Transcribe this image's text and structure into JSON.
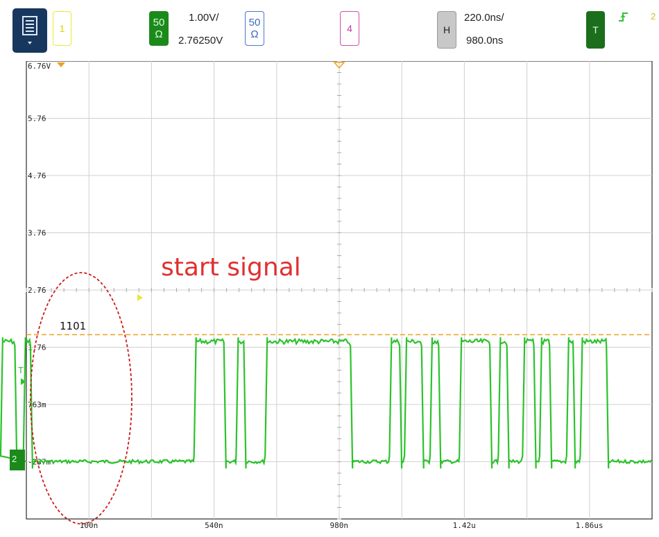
{
  "toolbar": {
    "ch1": {
      "label": "1",
      "color": "#e8e83a"
    },
    "ch2": {
      "top": "50",
      "bottom": "Ω",
      "color": "#1b8a1b"
    },
    "ch2_scale": "1.00V/",
    "ch2_offset": "2.76250V",
    "ch3": {
      "top": "50",
      "bottom": "Ω",
      "color": "#4a78c8"
    },
    "ch4": {
      "label": "4",
      "color": "#d04fb0"
    },
    "horizontal": {
      "label": "H",
      "scale": "220.0ns/",
      "delay": "980.0ns"
    },
    "trigger": {
      "label": "T",
      "edge_icon": "rising-edge-icon",
      "channel": "2"
    }
  },
  "scope": {
    "y_labels": [
      "6.76V",
      "5.76",
      "4.76",
      "3.76",
      "2.76",
      "1.76",
      "763m",
      "-237m"
    ],
    "x_labels": [
      "100n",
      "540n",
      "980n",
      "1.42u",
      "1.86us"
    ],
    "ground_marker": "2",
    "trigger_marker": "T",
    "annotation_text": "start signal",
    "bits_label": "1101",
    "trace_color": "#2bc22b",
    "annotation_color": "#e03030",
    "threshold_color": "#f0a020"
  },
  "chart_data": {
    "type": "line",
    "title": "",
    "xlabel": "",
    "ylabel": "",
    "ylim": [
      -1.24,
      6.76
    ],
    "xlim": [
      -0.34,
      2.08
    ],
    "x_unit": "us",
    "y_unit": "V",
    "threshold_level": 1.98,
    "low_level": -0.237,
    "high_level": 1.86,
    "series": [
      {
        "values_description_omitted": true,
        "pulses_us": [
          [
            -0.21,
            -0.16
          ],
          [
            -0.13,
            -0.105
          ],
          [
            0.47,
            0.575
          ],
          [
            0.618,
            0.645
          ],
          [
            0.72,
            1.02
          ],
          [
            1.157,
            1.193
          ],
          [
            1.21,
            1.27
          ],
          [
            1.3,
            1.33
          ],
          [
            1.403,
            1.51
          ],
          [
            1.54,
            1.57
          ],
          [
            1.625,
            1.665
          ],
          [
            1.685,
            1.72
          ],
          [
            1.78,
            1.803
          ],
          [
            1.828,
            1.92
          ]
        ]
      }
    ]
  }
}
